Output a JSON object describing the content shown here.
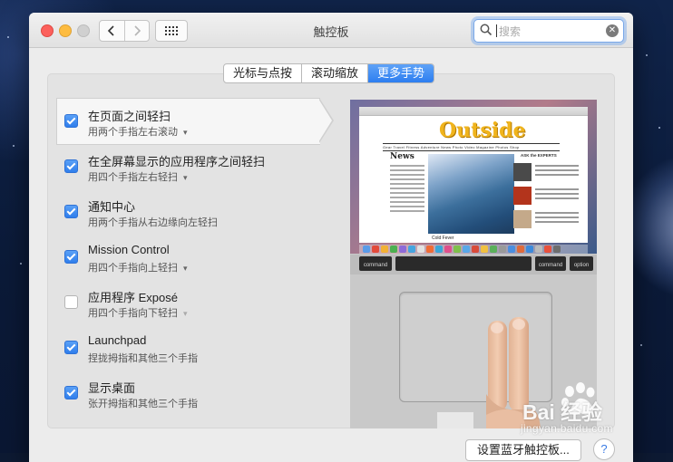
{
  "window": {
    "title": "触控板",
    "search_placeholder": "搜索"
  },
  "tabs": [
    {
      "label": "光标与点按",
      "active": false
    },
    {
      "label": "滚动缩放",
      "active": false
    },
    {
      "label": "更多手势",
      "active": true
    }
  ],
  "gestures": [
    {
      "name": "在页面之间轻扫",
      "sub": "用两个手指左右滚动",
      "checked": true,
      "has_menu": true,
      "selected": true
    },
    {
      "name": "在全屏幕显示的应用程序之间轻扫",
      "sub": "用四个手指左右轻扫",
      "checked": true,
      "has_menu": true
    },
    {
      "name": "通知中心",
      "sub": "用两个手指从右边缘向左轻扫",
      "checked": true,
      "has_menu": false
    },
    {
      "name": "Mission Control",
      "sub": "用四个手指向上轻扫",
      "checked": true,
      "has_menu": true
    },
    {
      "name": "应用程序 Exposé",
      "sub": "用四个手指向下轻扫",
      "checked": false,
      "has_menu": true,
      "menu_disabled": true
    },
    {
      "name": "Launchpad",
      "sub": "捏拢拇指和其他三个手指",
      "checked": true,
      "has_menu": false
    },
    {
      "name": "显示桌面",
      "sub": "张开拇指和其他三个手指",
      "checked": true,
      "has_menu": false
    }
  ],
  "preview": {
    "site_name": "Outside",
    "nav": "Gear   Travel   Fitness   Adventure   News   Photo   Video   Magazine   Photos   Shop",
    "section": "News",
    "caption": "Cold Fever",
    "experts": "ASK the EXPERTS",
    "keys": {
      "left": "command",
      "right1": "command",
      "right2": "option"
    }
  },
  "buttons": {
    "bluetooth": "设置蓝牙触控板...",
    "help": "?"
  },
  "watermark": {
    "brand": "Bai 经验",
    "url": "jingyan.baidu.com"
  },
  "colors": {
    "accent": "#2d7ef0",
    "close": "#fc605c",
    "minimize": "#fdbc40"
  }
}
